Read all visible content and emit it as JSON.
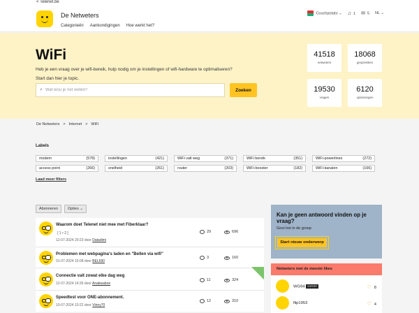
{
  "topbar": {
    "back_label": "< Telenet.be"
  },
  "header": {
    "site_name": "De Netweters",
    "nav": [
      "Categorieën",
      "Aankondigingen",
      "Hoe werkt het?"
    ],
    "user": {
      "name": "Couchpotato",
      "notifications": "1",
      "messages": "5",
      "language": "NL"
    }
  },
  "hero": {
    "title": "WiFi",
    "description": "Heb je een vraag over je wifi-bereik, hulp nodig om je instellingen of wifi-hardware te optimaliseren?",
    "start": "Start dan hier je topic.",
    "search_placeholder": "Wat wou je net weten?",
    "search_button": "Zoeken",
    "stats": [
      {
        "num": "41518",
        "label": "netweters"
      },
      {
        "num": "18068",
        "label": "gesprekken"
      },
      {
        "num": "19530",
        "label": "vragen"
      },
      {
        "num": "6120",
        "label": "oplossingen"
      }
    ]
  },
  "breadcrumb": [
    "De Netweters",
    ">",
    "Internet",
    ">",
    "WiFi"
  ],
  "labels": {
    "heading": "Labels",
    "items": [
      {
        "name": "modem",
        "count": "(578)"
      },
      {
        "name": "instellingen",
        "count": "(421)"
      },
      {
        "name": "WiFi valt weg",
        "count": "(371)"
      },
      {
        "name": "WiFi bereik",
        "count": "(351)"
      },
      {
        "name": "WiFi-powerlines",
        "count": "(272)"
      },
      {
        "name": "access point",
        "count": "(266)"
      },
      {
        "name": "snelheid",
        "count": "(261)"
      },
      {
        "name": "router",
        "count": "(203)"
      },
      {
        "name": "WiFi-booster",
        "count": "(182)"
      },
      {
        "name": "WiFi-kanalen",
        "count": "(166)"
      }
    ],
    "load_more": "Laad meer filters"
  },
  "toolbar": {
    "subscribe": "Abonneren",
    "options": "Opties"
  },
  "posts": [
    {
      "title": "Waarom doet Telenet niet mee met Fiberklaar?",
      "pages": "[ 1 • 2 ]",
      "date": "12-07-2024 20:23",
      "by": "door",
      "author": "Datadimi",
      "replies": "29",
      "views": "696"
    },
    {
      "title": "Problemen met webpagina's laden en \"Bellen via wifi\"",
      "pages": "",
      "date": "01-07-2024 15:08",
      "by": "door",
      "author": "BEL690",
      "replies": "3",
      "views": "160"
    },
    {
      "title": "Connectie valt zowat elke dag weg",
      "pages": "",
      "date": "12-07-2024 14:36",
      "by": "door",
      "author": "Anakwaboe",
      "replies": "11",
      "views": "324"
    },
    {
      "title": "Speedtest voor ONE-abonnement.",
      "pages": "",
      "date": "10-07-2024 10:22",
      "by": "door",
      "author": "Vinny70",
      "replies": "12",
      "views": "310"
    }
  ],
  "ask": {
    "title": "Kan je geen antwoord vinden op je vraag?",
    "subtitle": "Gooi het in de groep",
    "button": "Start nieuw onderwerp"
  },
  "likes": {
    "heading": "Netweters met de meeste likes",
    "users": [
      {
        "name": "WG94",
        "badge": "EXPERT",
        "count": "8"
      },
      {
        "name": "flip1953",
        "badge": "",
        "count": "4"
      }
    ]
  },
  "colors": {
    "brand_yellow": "#ffc421",
    "hero_bg": "#fef3c7",
    "ask_bg": "#9fb3c9",
    "likes_header": "#fa7a6b"
  }
}
